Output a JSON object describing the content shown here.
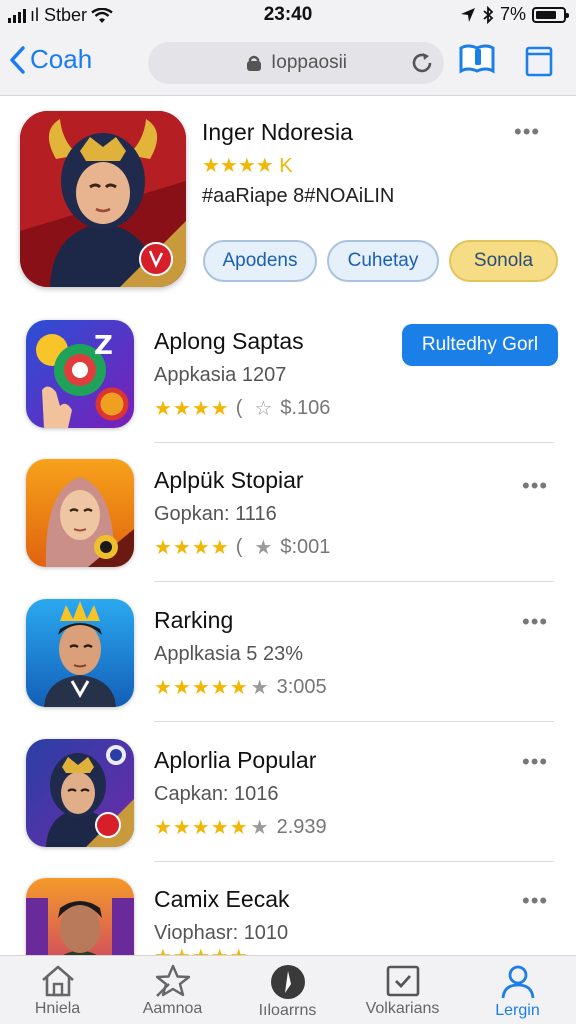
{
  "status": {
    "carrier": "ıl Stber",
    "time": "23:40",
    "battery": "7%"
  },
  "nav": {
    "back_label": "Coah",
    "search_text": "Ioppaosii"
  },
  "featured": {
    "title": "Inger Ndoresia",
    "rating_text": "★★★★ K",
    "tagline": "#aaRiape 8#NOAiLIN",
    "buttons": [
      "Apodens",
      "Cuhetay",
      "Sonola"
    ]
  },
  "apps": [
    {
      "title": "Aplong Saptas",
      "subtitle": "Appkasia 1207",
      "stars": 4,
      "rating_value": "$.106",
      "button": "Rultedhy Gorl"
    },
    {
      "title": "Aplpük Stopiar",
      "subtitle": "Gopkan: 1116",
      "stars": 4,
      "rating_value": "$:001"
    },
    {
      "title": "Rarking",
      "subtitle": "Applkasia 5 23%",
      "stars": 5,
      "rating_value": "3:005"
    },
    {
      "title": "Aplorlia Popular",
      "subtitle": "Capkan: 1016",
      "stars": 5,
      "rating_value": "2.939"
    },
    {
      "title": "Camix Eecak",
      "subtitle": "Viophasr: 1010",
      "stars": 5,
      "rating_value": ""
    }
  ],
  "tabbar": {
    "tabs": [
      "Hniela",
      "Aamnoa",
      "Iıloarrns",
      "Volkarians",
      "Lergin"
    ],
    "active_index": 4
  },
  "colors": {
    "accent": "#1b7fe8",
    "star": "#f2b705",
    "gold_pill": "#f6dc84"
  }
}
